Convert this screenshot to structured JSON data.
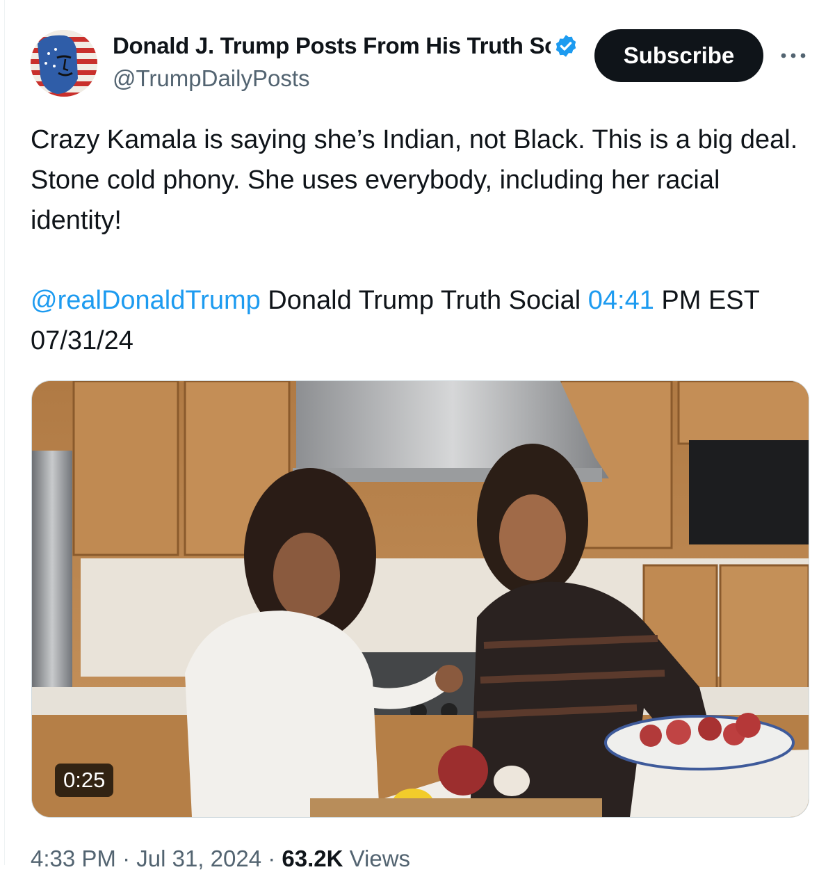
{
  "author": {
    "display_name": "Donald J. Trump Posts From His Truth Social",
    "handle": "@TrumpDailyPosts",
    "verified": true,
    "verified_color": "#1d9bf0"
  },
  "actions": {
    "subscribe_label": "Subscribe",
    "more_glyph": "···"
  },
  "post": {
    "text": "Crazy Kamala is saying she’s Indian, not Black. This is a big deal. Stone cold phony. She uses everybody, including her racial identity!",
    "mention": "@realDonaldTrump",
    "source_text": " Donald Trump Truth Social ",
    "time_link": "04:41",
    "time_rest": " PM EST 07/31/24"
  },
  "media": {
    "type": "video",
    "duration": "0:25"
  },
  "meta": {
    "time": "4:33 PM",
    "separator": " · ",
    "date": "Jul 31, 2024",
    "views_count": "63.2K",
    "views_label": " Views"
  },
  "colors": {
    "text": "#0f1419",
    "secondary": "#536471",
    "link": "#1d9bf0",
    "button_bg": "#0f1419"
  }
}
